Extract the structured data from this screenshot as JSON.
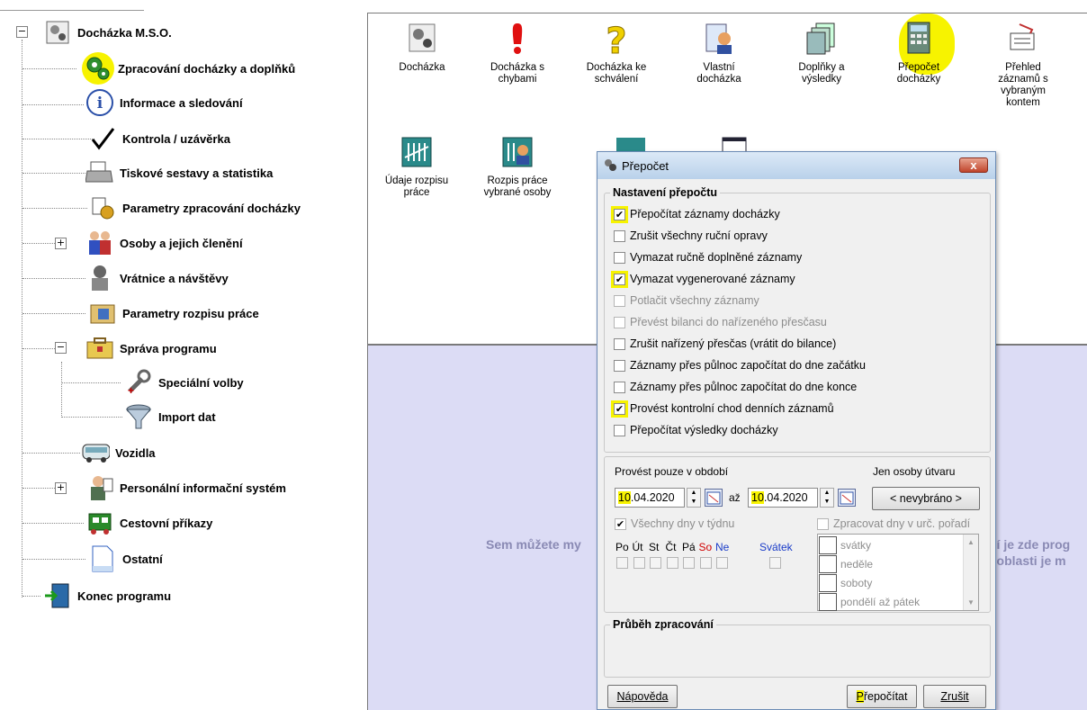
{
  "tree": {
    "root": "Docházka M.S.O.",
    "items": [
      {
        "label": "Zpracování docházky a doplňků",
        "icon": "gears-icon"
      },
      {
        "label": "Informace a sledování",
        "icon": "info-icon"
      },
      {
        "label": "Kontrola / uzávěrka",
        "icon": "checkmark-icon"
      },
      {
        "label": "Tiskové sestavy a statistika",
        "icon": "printer-icon"
      },
      {
        "label": "Parametry zpracování docházky",
        "icon": "parameters-icon"
      },
      {
        "label": "Osoby a jejich členění",
        "icon": "people-icon"
      },
      {
        "label": "Vrátnice a návštěvy",
        "icon": "gatekeeper-icon"
      },
      {
        "label": "Parametry rozpisu práce",
        "icon": "work-schedule-icon"
      },
      {
        "label": "Správa programu",
        "icon": "toolbox-icon"
      },
      {
        "label": "Speciální volby",
        "icon": "wrench-icon"
      },
      {
        "label": "Import dat",
        "icon": "funnel-icon"
      },
      {
        "label": "Vozidla",
        "icon": "bus-icon"
      },
      {
        "label": "Personální informační systém",
        "icon": "personnel-icon"
      },
      {
        "label": "Cestovní příkazy",
        "icon": "train-icon"
      },
      {
        "label": "Ostatní",
        "icon": "document-icon"
      },
      {
        "label": "Konec programu",
        "icon": "exit-door-icon"
      }
    ]
  },
  "tools": [
    {
      "label": "Docházka"
    },
    {
      "label": "Docházka s chybami"
    },
    {
      "label": "Docházka ke schválení"
    },
    {
      "label": "Vlastní docházka"
    },
    {
      "label": "Doplňky a výsledky"
    },
    {
      "label": "Přepočet docházky"
    },
    {
      "label": "Přehled záznamů s vybraným kontem"
    },
    {
      "label": "Údaje rozpisu práce"
    },
    {
      "label": "Rozpis práce vybrané osoby"
    }
  ],
  "bluearea": {
    "left_text": "Sem můžete my",
    "right_text_1": "ní je zde prog",
    "right_text_2": "t oblasti je m"
  },
  "dialog": {
    "title": "Přepočet",
    "close": "x",
    "settings_legend": "Nastavení přepočtu",
    "options": [
      {
        "label": "Přepočítat záznamy docházky",
        "checked": true,
        "disabled": false
      },
      {
        "label": "Zrušit všechny ruční opravy",
        "checked": false,
        "disabled": false
      },
      {
        "label": "Vymazat ručně doplněné záznamy",
        "checked": false,
        "disabled": false
      },
      {
        "label": "Vymazat vygenerované záznamy",
        "checked": true,
        "disabled": false
      },
      {
        "label": "Potlačit všechny záznamy",
        "checked": false,
        "disabled": true
      },
      {
        "label": "Převést bilanci do nařízeného přesčasu",
        "checked": false,
        "disabled": true
      },
      {
        "label": "Zrušit nařízený přesčas (vrátit do bilance)",
        "checked": false,
        "disabled": false
      },
      {
        "label": "Záznamy přes půlnoc započítat do dne začátku",
        "checked": false,
        "disabled": false
      },
      {
        "label": "Záznamy přes půlnoc započítat do dne konce",
        "checked": false,
        "disabled": false
      },
      {
        "label": "Provést kontrolní chod denních záznamů",
        "checked": true,
        "disabled": false
      },
      {
        "label": "Přepočítat výsledky docházky",
        "checked": false,
        "disabled": false
      }
    ],
    "period_label": "Provést pouze v období",
    "unit_label": "Jen osoby útvaru",
    "date_from_hl": "10",
    "date_from_rest": ".04.2020",
    "to_label": "až",
    "date_to_hl": "10",
    "date_to_rest": ".04.2020",
    "unit_button": "< nevybráno >",
    "all_days_label": "Všechny dny v týdnu",
    "order_days_label": "Zpracovat dny v urč. pořadí",
    "days": [
      "Po",
      "Út",
      "St",
      "Čt",
      "Pá",
      "So",
      "Ne"
    ],
    "holiday_label": "Svátek",
    "list_items": [
      "svátky",
      "neděle",
      "soboty",
      "pondělí až pátek"
    ],
    "progress_legend": "Průběh zpracování",
    "help_button": "Nápověda",
    "recalc_button_hl": "P",
    "recalc_button_rest": "řepočítat",
    "cancel_button": "Zrušit"
  },
  "colors": {
    "highlight": "#f7f300",
    "blue_area": "#dcdcf5",
    "weekend_red": "#d00000",
    "holiday_blue": "#1a3cc8"
  }
}
